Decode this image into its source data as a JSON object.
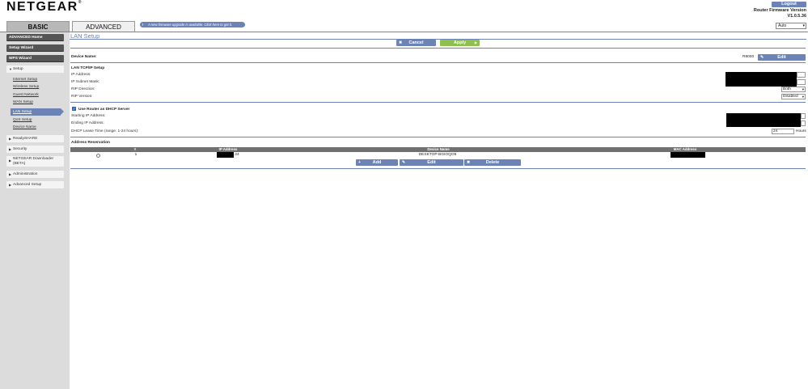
{
  "brand": {
    "logo": "NETGEAR",
    "reg": "®"
  },
  "header": {
    "logout_label": "Logout",
    "fw_label": "Router Firmware Version",
    "fw_version": "V1.0.5.36",
    "language_select": "Auto"
  },
  "tabs": [
    {
      "label": "BASIC",
      "active": false
    },
    {
      "label": "ADVANCED",
      "active": true
    }
  ],
  "notice": {
    "text": "A new firmware upgrade is available. Click here to get it."
  },
  "sidebar": {
    "top_buttons": [
      "ADVANCED Home",
      "Setup Wizard",
      "WPS Wizard"
    ],
    "setup_section": "Setup",
    "setup_links": [
      "Internet Setup",
      "Wireless Setup",
      "Guest Network",
      "WAN Setup",
      "LAN Setup",
      "QoS Setup",
      "Device Name"
    ],
    "active_link": "LAN Setup",
    "sections": [
      "ReadySHARE",
      "Security",
      "NETGEAR Downloader",
      "(BETA)",
      "Administration",
      "Advanced Setup"
    ]
  },
  "main": {
    "title": "LAN Setup",
    "cancel_label": "Cancel",
    "apply_label": "Apply",
    "device_name_label": "Device Name:",
    "device_name_value": "R8000",
    "edit_label": "Edit",
    "tcpip_heading": "LAN TCP/IP Setup",
    "ip_address_label": "IP Address:",
    "subnet_label": "IP Subnet Mask:",
    "rip_direction_label": "RIP Direction:",
    "rip_direction_value": "Both",
    "rip_version_label": "RIP Version:",
    "rip_version_value": "Disabled",
    "dhcp_checkbox_label": "Use Router as DHCP Server",
    "starting_ip_label": "Starting IP Address:",
    "ending_ip_label": "Ending IP Address:",
    "lease_label": "DHCP Lease Time (range: 1-24 hours):",
    "lease_value": "24",
    "lease_unit": "Hours",
    "reservation_heading": "Address Reservation",
    "table": {
      "headers": [
        "#",
        "IP Address",
        "Device Name",
        "MAC Address"
      ],
      "rows": [
        {
          "num": "1",
          "ip_suffix": ".24",
          "device": "DESKTOP-BGIOQO5"
        }
      ]
    },
    "add_label": "Add",
    "delete_label": "Delete"
  }
}
